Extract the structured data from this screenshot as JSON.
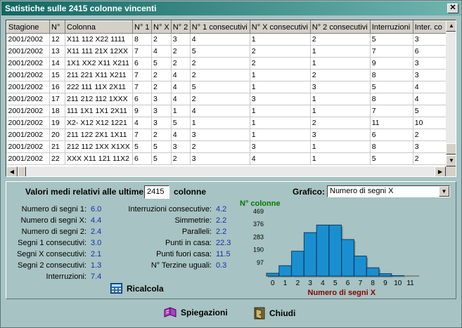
{
  "window": {
    "title": "Satistiche sulle 2415 colonne vincenti",
    "close_symbol": "✕"
  },
  "grid": {
    "headers": [
      "Stagione",
      "N°",
      "Colonna",
      "N° 1",
      "N° X",
      "N° 2",
      "N° 1 consecutivi",
      "N° X consecutivi",
      "N° 2 consecutivi",
      "Interruzioni",
      "Inter. co"
    ],
    "rows": [
      [
        "2001/2002",
        "12",
        "X11 112 X22 1111",
        "8",
        "2",
        "3",
        "4",
        "1",
        "2",
        "5",
        "3"
      ],
      [
        "2001/2002",
        "13",
        "X11 111 21X 12XX",
        "7",
        "4",
        "2",
        "5",
        "2",
        "1",
        "7",
        "6"
      ],
      [
        "2001/2002",
        "14",
        "1X1 XX2 X11 X211",
        "6",
        "5",
        "2",
        "2",
        "2",
        "1",
        "9",
        "3"
      ],
      [
        "2001/2002",
        "15",
        "211 221 X11 X211",
        "7",
        "2",
        "4",
        "2",
        "1",
        "2",
        "8",
        "3"
      ],
      [
        "2001/2002",
        "16",
        "222 111 11X 2X11",
        "7",
        "2",
        "4",
        "5",
        "1",
        "3",
        "5",
        "4"
      ],
      [
        "2001/2002",
        "17",
        "211 212 112 1XXX",
        "6",
        "3",
        "4",
        "2",
        "3",
        "1",
        "8",
        "4"
      ],
      [
        "2001/2002",
        "18",
        "111 1X1 1X1 2X11",
        "9",
        "3",
        "1",
        "4",
        "1",
        "1",
        "7",
        "5"
      ],
      [
        "2001/2002",
        "19",
        "X2- X12 X12 1221",
        "4",
        "3",
        "5",
        "1",
        "1",
        "2",
        "11",
        "10"
      ],
      [
        "2001/2002",
        "20",
        "211 122 2X1 1X11",
        "7",
        "2",
        "4",
        "3",
        "1",
        "3",
        "6",
        "2"
      ],
      [
        "2001/2002",
        "21",
        "212 112 1XX X1XX",
        "5",
        "5",
        "3",
        "2",
        "3",
        "1",
        "8",
        "3"
      ],
      [
        "2001/2002",
        "22",
        "XXX X11 121 11X2",
        "6",
        "5",
        "2",
        "3",
        "4",
        "1",
        "5",
        "2"
      ]
    ]
  },
  "averages": {
    "prefix": "Valori medi relativi alle ultime",
    "count": "2415",
    "suffix": "colonne",
    "left_stats": [
      {
        "label": "Numero di segni 1:",
        "value": "6.0"
      },
      {
        "label": "Numero di segni X:",
        "value": "4.4"
      },
      {
        "label": "Numero di segni 2:",
        "value": "2.4"
      },
      {
        "label": "Segni 1 consecutivi:",
        "value": "3.0"
      },
      {
        "label": "Segni X consecutivi:",
        "value": "2.1"
      },
      {
        "label": "Segni 2 consecutivi:",
        "value": "1.3"
      },
      {
        "label": "Interruzioni:",
        "value": "7.4"
      }
    ],
    "right_stats": [
      {
        "label": "Interruzioni consecutive:",
        "value": "4.2"
      },
      {
        "label": "Simmetrie:",
        "value": "2.2"
      },
      {
        "label": "Paralleli:",
        "value": "2.2"
      },
      {
        "label": "Punti in casa:",
        "value": "22.3"
      },
      {
        "label": "Punti fuori casa:",
        "value": "11.5"
      },
      {
        "label": "N° Terzine uguali:",
        "value": "0.3"
      }
    ],
    "ricalcola": "Ricalcola"
  },
  "graph": {
    "label": "Grafico:",
    "selected": "Numero di segni X",
    "arrow": "▼"
  },
  "chart_data": {
    "type": "bar",
    "title": "",
    "ylabel": "N° colonne",
    "xlabel": "Numero di segni X",
    "categories": [
      "0",
      "1",
      "2",
      "3",
      "4",
      "5",
      "6",
      "7",
      "8",
      "9",
      "10",
      "11"
    ],
    "values": [
      20,
      75,
      180,
      315,
      370,
      370,
      265,
      145,
      60,
      17,
      3,
      0
    ],
    "yticks": [
      97,
      190,
      283,
      376,
      469
    ],
    "ylim": [
      0,
      469
    ],
    "bar_color": "#1a8fd0",
    "title_color": "#007a00",
    "xlabel_color": "#8b0000"
  },
  "footer": {
    "spiegazioni": "Spiegazioni",
    "chiudi": "Chiudi"
  }
}
